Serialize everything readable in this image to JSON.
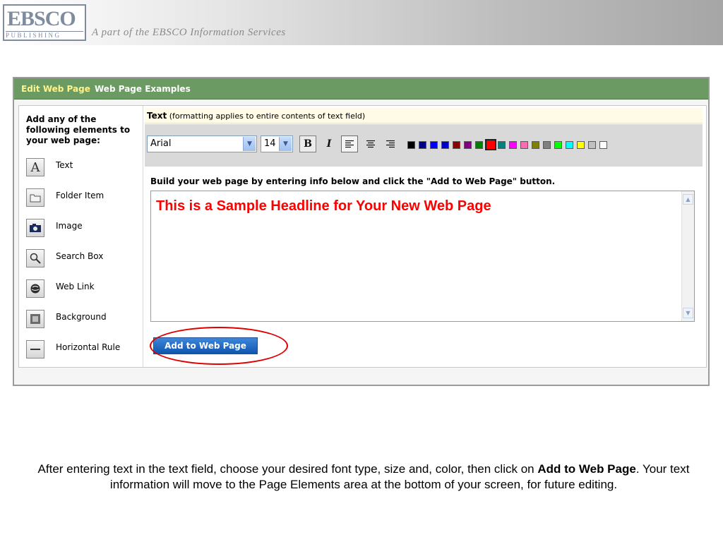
{
  "header": {
    "logo_main": "EBSCO",
    "logo_sub": "PUBLISHING",
    "tagline": "A part of the EBSCO Information Services"
  },
  "window": {
    "tabs": [
      "Edit Web Page",
      "Web Page Examples"
    ]
  },
  "sidebar": {
    "heading": "Add any of the following elements to your web page:",
    "items": [
      {
        "label": "Text",
        "icon": "text-icon"
      },
      {
        "label": "Folder Item",
        "icon": "folder-icon"
      },
      {
        "label": "Image",
        "icon": "camera-icon"
      },
      {
        "label": "Search Box",
        "icon": "magnifier-icon"
      },
      {
        "label": "Web Link",
        "icon": "globe-icon"
      },
      {
        "label": "Background",
        "icon": "background-icon"
      },
      {
        "label": "Horizontal Rule",
        "icon": "horizontal-rule-icon"
      }
    ]
  },
  "text_panel": {
    "title": "Text",
    "note": "(formatting applies to entire contents of text field)",
    "font": "Arial",
    "size": "14",
    "colors": [
      "#000000",
      "#00008b",
      "#0000ff",
      "#0000cd",
      "#8b0000",
      "#800080",
      "#008000",
      "#ff0000",
      "#008080",
      "#ff00ff",
      "#ff69b4",
      "#808000",
      "#808080",
      "#00ff00",
      "#00ffff",
      "#ffff00",
      "#c0c0c0",
      "#ffffff"
    ],
    "selected_color": "#ff0000",
    "instruction": "Build your web page by entering info below and click the \"Add to Web Page\" button.",
    "editor_text": "This is a Sample Headline for Your New Web Page",
    "add_button": "Add to Web Page"
  },
  "caption": {
    "part1": "After entering text in the text field, choose your desired font type, size and, color, then click on ",
    "bold": "Add to Web Page",
    "part2": ". Your text information will move to the Page Elements area at the bottom of your screen, for future editing."
  }
}
